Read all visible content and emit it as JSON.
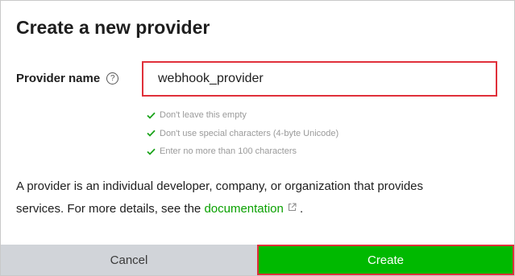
{
  "dialog": {
    "title": "Create a new provider",
    "field_label": "Provider name",
    "help_glyph": "?",
    "input_value": "webhook_provider",
    "rules": [
      "Don't leave this empty",
      "Don't use special characters (4-byte Unicode)",
      "Enter no more than 100 characters"
    ],
    "description_before": "A provider is an individual developer, company, or organization that provides services. For more details, see the ",
    "documentation_link": "documentation",
    "description_after": " .",
    "cancel_label": "Cancel",
    "create_label": "Create"
  },
  "colors": {
    "accent_green": "#00b900",
    "highlight_red": "#e0303a",
    "cancel_bg": "#d1d4d9"
  },
  "icons": [
    "help-icon",
    "check-icon",
    "external-link-icon"
  ]
}
